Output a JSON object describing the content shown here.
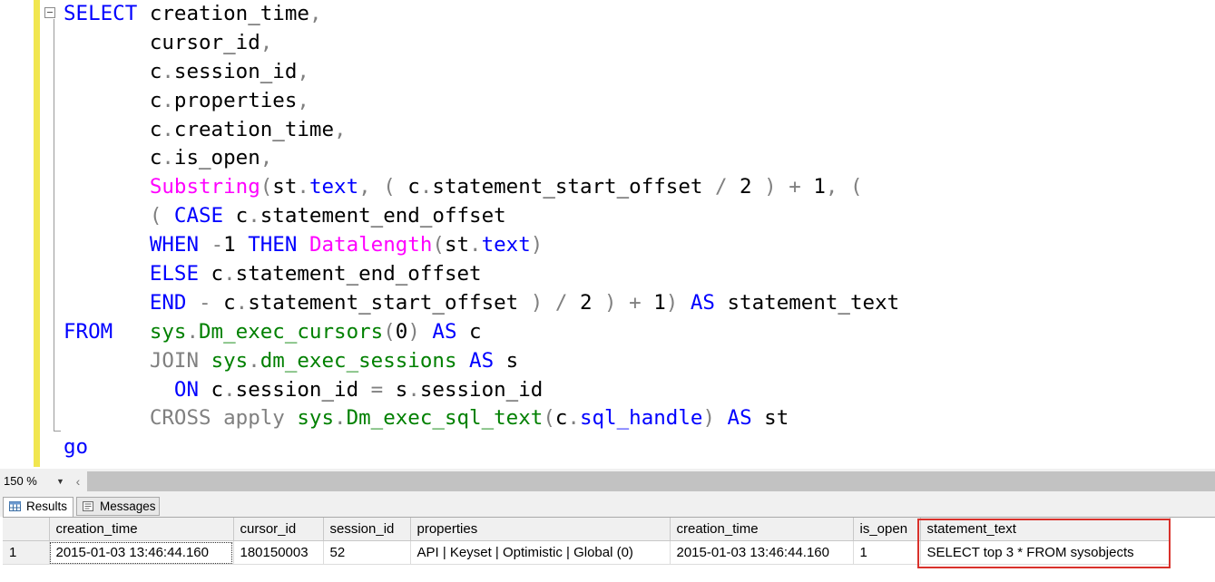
{
  "editor": {
    "lines": [
      [
        [
          "kw",
          "SELECT"
        ],
        [
          "t",
          " creation_time"
        ],
        [
          "op",
          ","
        ]
      ],
      [
        [
          "t",
          "       cursor_id"
        ],
        [
          "op",
          ","
        ]
      ],
      [
        [
          "t",
          "       c"
        ],
        [
          "op",
          "."
        ],
        [
          "t",
          "session_id"
        ],
        [
          "op",
          ","
        ]
      ],
      [
        [
          "t",
          "       c"
        ],
        [
          "op",
          "."
        ],
        [
          "t",
          "properties"
        ],
        [
          "op",
          ","
        ]
      ],
      [
        [
          "t",
          "       c"
        ],
        [
          "op",
          "."
        ],
        [
          "t",
          "creation_time"
        ],
        [
          "op",
          ","
        ]
      ],
      [
        [
          "t",
          "       c"
        ],
        [
          "op",
          "."
        ],
        [
          "t",
          "is_open"
        ],
        [
          "op",
          ","
        ]
      ],
      [
        [
          "t",
          "       "
        ],
        [
          "fn",
          "Substring"
        ],
        [
          "op",
          "("
        ],
        [
          "t",
          "st"
        ],
        [
          "op",
          "."
        ],
        [
          "kw",
          "text"
        ],
        [
          "op",
          ","
        ],
        [
          "t",
          " "
        ],
        [
          "op",
          "("
        ],
        [
          "t",
          " c"
        ],
        [
          "op",
          "."
        ],
        [
          "t",
          "statement_start_offset "
        ],
        [
          "op",
          "/"
        ],
        [
          "t",
          " 2 "
        ],
        [
          "op",
          ")"
        ],
        [
          "t",
          " "
        ],
        [
          "op",
          "+"
        ],
        [
          "t",
          " 1"
        ],
        [
          "op",
          ","
        ],
        [
          "t",
          " "
        ],
        [
          "op",
          "("
        ]
      ],
      [
        [
          "t",
          "       "
        ],
        [
          "op",
          "("
        ],
        [
          "t",
          " "
        ],
        [
          "kw",
          "CASE"
        ],
        [
          "t",
          " c"
        ],
        [
          "op",
          "."
        ],
        [
          "t",
          "statement_end_offset"
        ]
      ],
      [
        [
          "t",
          "       "
        ],
        [
          "kw",
          "WHEN"
        ],
        [
          "t",
          " "
        ],
        [
          "op",
          "-"
        ],
        [
          "t",
          "1 "
        ],
        [
          "kw",
          "THEN"
        ],
        [
          "t",
          " "
        ],
        [
          "fn",
          "Datalength"
        ],
        [
          "op",
          "("
        ],
        [
          "t",
          "st"
        ],
        [
          "op",
          "."
        ],
        [
          "kw",
          "text"
        ],
        [
          "op",
          ")"
        ]
      ],
      [
        [
          "t",
          "       "
        ],
        [
          "kw",
          "ELSE"
        ],
        [
          "t",
          " c"
        ],
        [
          "op",
          "."
        ],
        [
          "t",
          "statement_end_offset"
        ]
      ],
      [
        [
          "t",
          "       "
        ],
        [
          "kw",
          "END"
        ],
        [
          "t",
          " "
        ],
        [
          "op",
          "-"
        ],
        [
          "t",
          " c"
        ],
        [
          "op",
          "."
        ],
        [
          "t",
          "statement_start_offset "
        ],
        [
          "op",
          ")"
        ],
        [
          "t",
          " "
        ],
        [
          "op",
          "/"
        ],
        [
          "t",
          " 2 "
        ],
        [
          "op",
          ")"
        ],
        [
          "t",
          " "
        ],
        [
          "op",
          "+"
        ],
        [
          "t",
          " 1"
        ],
        [
          "op",
          ")"
        ],
        [
          "t",
          " "
        ],
        [
          "kw",
          "AS"
        ],
        [
          "t",
          " statement_text"
        ]
      ],
      [
        [
          "kw",
          "FROM"
        ],
        [
          "t",
          "   "
        ],
        [
          "sys",
          "sys"
        ],
        [
          "op",
          "."
        ],
        [
          "sys",
          "Dm_exec_cursors"
        ],
        [
          "op",
          "("
        ],
        [
          "t",
          "0"
        ],
        [
          "op",
          ")"
        ],
        [
          "t",
          " "
        ],
        [
          "kw",
          "AS"
        ],
        [
          "t",
          " c"
        ]
      ],
      [
        [
          "t",
          "       "
        ],
        [
          "op",
          "JOIN"
        ],
        [
          "t",
          " "
        ],
        [
          "sys",
          "sys"
        ],
        [
          "op",
          "."
        ],
        [
          "sys",
          "dm_exec_sessions"
        ],
        [
          "t",
          " "
        ],
        [
          "kw",
          "AS"
        ],
        [
          "t",
          " s"
        ]
      ],
      [
        [
          "t",
          "         "
        ],
        [
          "kw",
          "ON"
        ],
        [
          "t",
          " c"
        ],
        [
          "op",
          "."
        ],
        [
          "t",
          "session_id "
        ],
        [
          "op",
          "="
        ],
        [
          "t",
          " s"
        ],
        [
          "op",
          "."
        ],
        [
          "t",
          "session_id"
        ]
      ],
      [
        [
          "t",
          "       "
        ],
        [
          "op",
          "CROSS"
        ],
        [
          "t",
          " "
        ],
        [
          "op",
          "apply"
        ],
        [
          "t",
          " "
        ],
        [
          "sys",
          "sys"
        ],
        [
          "op",
          "."
        ],
        [
          "sys",
          "Dm_exec_sql_text"
        ],
        [
          "op",
          "("
        ],
        [
          "t",
          "c"
        ],
        [
          "op",
          "."
        ],
        [
          "kw",
          "sql_handle"
        ],
        [
          "op",
          ")"
        ],
        [
          "t",
          " "
        ],
        [
          "kw",
          "AS"
        ],
        [
          "t",
          " st"
        ]
      ],
      [
        [
          "kw",
          "go"
        ]
      ]
    ]
  },
  "statusbar": {
    "zoom": "150 %",
    "scroll_left": "‹"
  },
  "tabs": {
    "results": "Results",
    "messages": "Messages"
  },
  "grid": {
    "columns": [
      "",
      "creation_time",
      "cursor_id",
      "session_id",
      "properties",
      "creation_time",
      "is_open",
      "statement_text"
    ],
    "rows": [
      [
        "1",
        "2015-01-03 13:46:44.160",
        "180150003",
        "52",
        "API | Keyset | Optimistic | Global (0)",
        "2015-01-03 13:46:44.160",
        "1",
        "SELECT top 3 * FROM sysobjects"
      ]
    ]
  },
  "colors": {
    "keyword": "#0000ff",
    "function": "#ff00ff",
    "system_object": "#008000",
    "operator": "#808080",
    "gutter": "#f1e64f",
    "highlight": "#d9312b"
  }
}
